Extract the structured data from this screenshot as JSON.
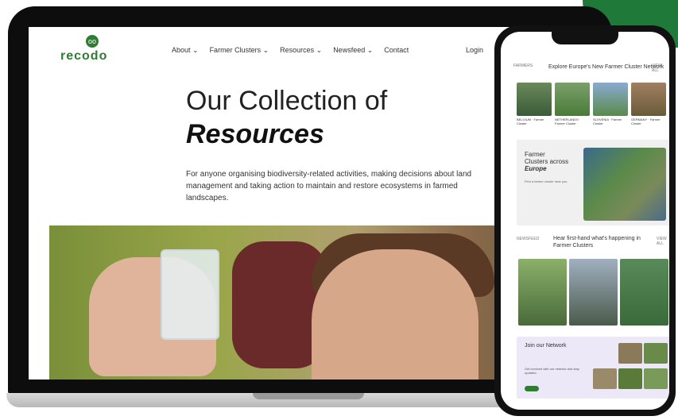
{
  "brand": {
    "name": "recodo",
    "mark": "oo"
  },
  "nav": {
    "items": [
      "About ⌄",
      "Farmer Clusters ⌄",
      "Resources ⌄",
      "Newsfeed ⌄",
      "Contact"
    ],
    "login": "Login"
  },
  "hero": {
    "title_line1": "Our Collection of",
    "title_line2": "Resources",
    "lead": "For anyone organising biodiversity-related activities, making decisions about land management and taking action to maintain and restore ecosystems in farmed landscapes."
  },
  "phone": {
    "section1": {
      "tag": "FARMERS",
      "title": "Explore Europe's New Farmer Cluster Network",
      "more": "VIEW ALL"
    },
    "cards": [
      {
        "caption": "BELGIUM · Farmer Cluster"
      },
      {
        "caption": "NETHERLANDS · Farmer Cluster"
      },
      {
        "caption": "SLOVENIA · Farmer Cluster"
      },
      {
        "caption": "GERMANY · Farmer Cluster"
      }
    ],
    "map": {
      "title_line1": "Farmer",
      "title_line2": "Clusters across",
      "title_line3": "Europe",
      "text": "Find a farmer cluster near you."
    },
    "section2": {
      "tag": "NEWSFEED",
      "title": "Hear first-hand what's happening in Farmer Clusters",
      "more": "VIEW ALL"
    },
    "join": {
      "title": "Join our Network",
      "text": "Get involved with our network and stay updated."
    }
  }
}
